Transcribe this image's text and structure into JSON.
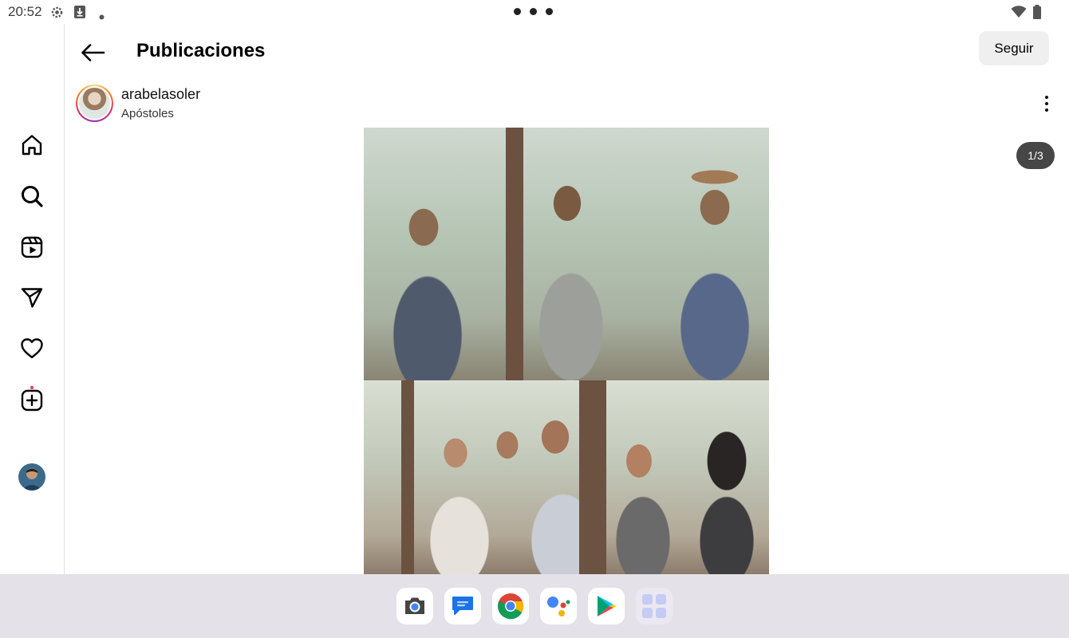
{
  "status_bar": {
    "time": "20:52",
    "icons": [
      "settings-gear-icon",
      "download-icon",
      "dot-icon",
      "wifi-icon",
      "battery-icon"
    ]
  },
  "header": {
    "title": "Publicaciones",
    "follow_label": "Seguir"
  },
  "sidebar": {
    "items": [
      {
        "name": "home",
        "icon": "home-icon"
      },
      {
        "name": "search",
        "icon": "search-icon"
      },
      {
        "name": "reels",
        "icon": "reels-icon"
      },
      {
        "name": "direct",
        "icon": "send-icon"
      },
      {
        "name": "activity",
        "icon": "heart-icon",
        "has_notification": true
      },
      {
        "name": "create",
        "icon": "plus-square-icon"
      },
      {
        "name": "profile",
        "icon": "profile-avatar"
      }
    ]
  },
  "post": {
    "username": "arabelasoler",
    "location": "Apóstoles",
    "page_indicator": "1/3",
    "current_page": 1,
    "total_pages": 3
  },
  "dock": {
    "apps": [
      "camera-app-icon",
      "messages-app-icon",
      "chrome-app-icon",
      "assistant-app-icon",
      "play-store-app-icon",
      "app-drawer-icon"
    ]
  },
  "colors": {
    "notification_dot": "#ff3040",
    "follow_button_bg": "#efefef",
    "dock_bg": "#e4e2e8",
    "indicator_bg": "#262626"
  }
}
